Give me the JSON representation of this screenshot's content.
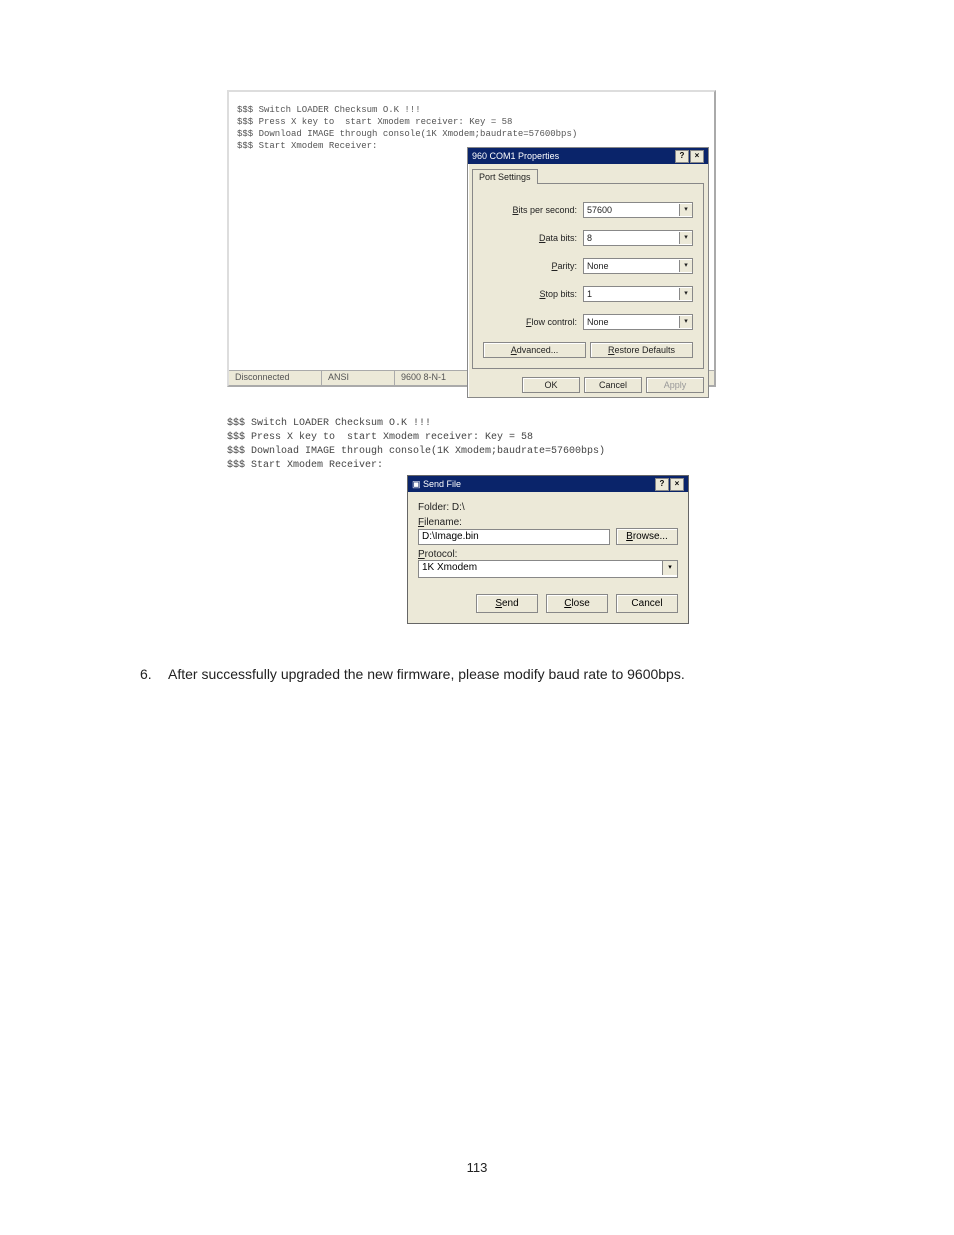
{
  "terminal1": {
    "lines": "$$$ Switch LOADER Checksum O.K !!!\n$$$ Press X key to  start Xmodem receiver: Key = 58\n$$$ Download IMAGE through console(1K Xmodem;baudrate=57600bps)\n$$$ Start Xmodem Receiver:",
    "status": {
      "connected": "Disconnected",
      "emu": "ANSI",
      "settings": "9600 8-N-1"
    }
  },
  "com_dialog": {
    "title_prefix": "960",
    "title": "COM1 Properties",
    "tab": "Port Settings",
    "fields": {
      "bps_label": "Bits per second:",
      "bps_value": "57600",
      "data_label": "Data bits:",
      "data_value": "8",
      "parity_label": "Parity:",
      "parity_value": "None",
      "stop_label": "Stop bits:",
      "stop_value": "1",
      "flow_label": "Flow control:",
      "flow_value": "None"
    },
    "advanced": "Advanced...",
    "restore": "Restore Defaults",
    "ok": "OK",
    "cancel": "Cancel",
    "apply": "Apply"
  },
  "terminal2": {
    "lines": "$$$ Switch LOADER Checksum O.K !!!\n$$$ Press X key to  start Xmodem receiver: Key = 58\n$$$ Download IMAGE through console(1K Xmodem;baudrate=57600bps)\n$$$ Start Xmodem Receiver:"
  },
  "send_dialog": {
    "title": "Send File",
    "folder_label": "Folder: D:\\",
    "filename_label": "Filename:",
    "filename_value": "D:\\Image.bin",
    "browse": "Browse...",
    "protocol_label": "Protocol:",
    "protocol_value": "1K Xmodem",
    "send": "Send",
    "close": "Close",
    "cancel": "Cancel"
  },
  "instruction": {
    "num": "6.",
    "text": "After successfully upgraded the new firmware, please modify baud rate to 9600bps."
  },
  "page_number": "113"
}
